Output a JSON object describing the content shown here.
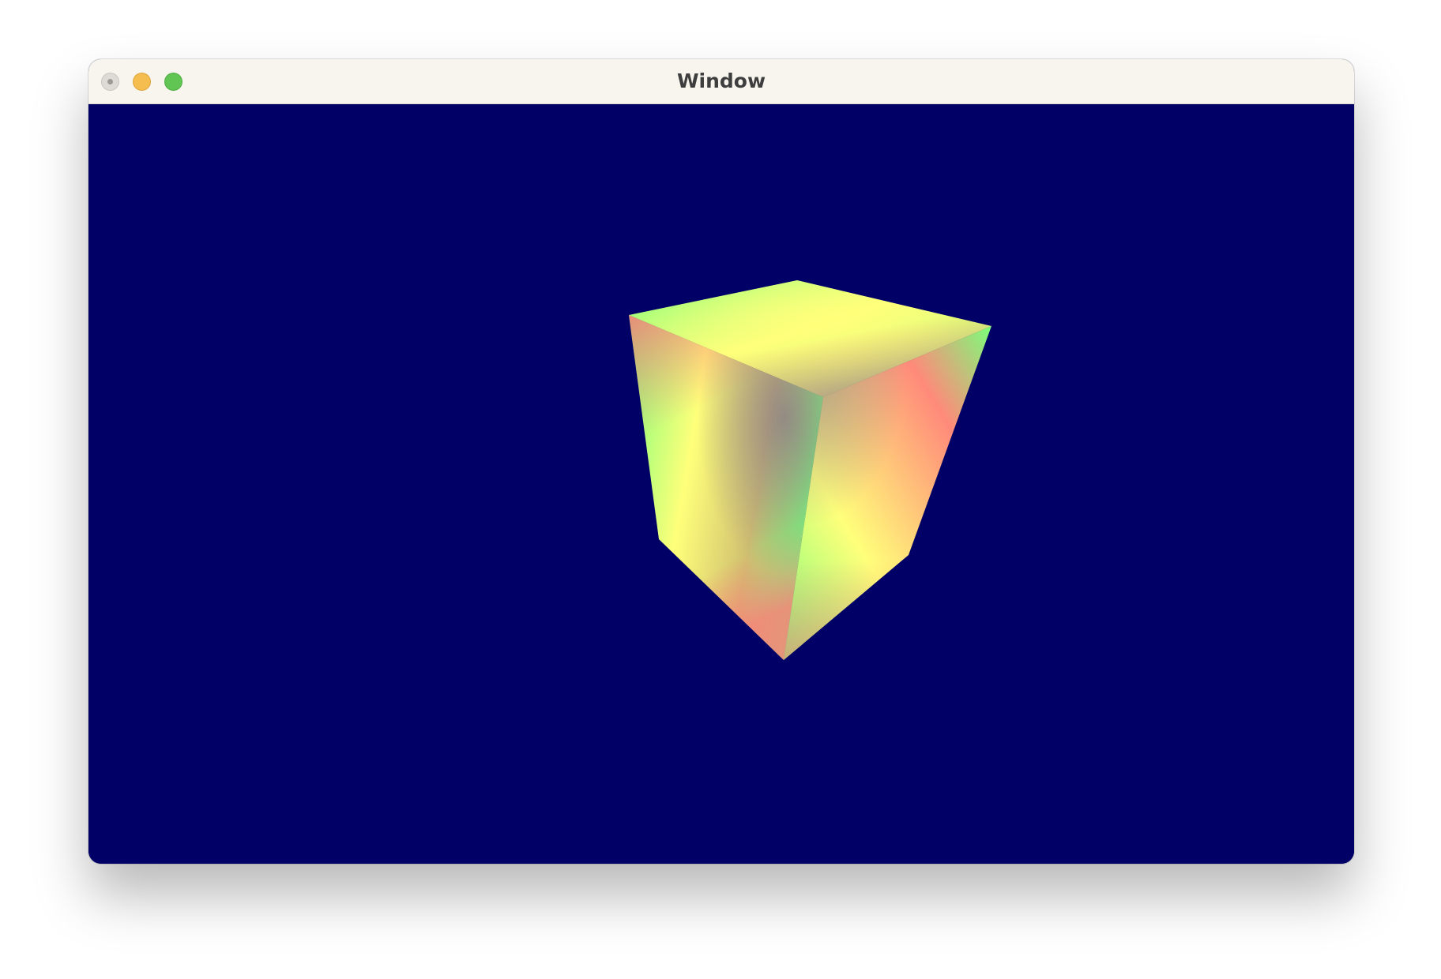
{
  "window": {
    "title": "Window",
    "background_color": "#000066"
  },
  "title_bar": {
    "buttons": [
      {
        "name": "close",
        "color": "#dedbd6"
      },
      {
        "name": "minimize",
        "color": "#f5bd4f"
      },
      {
        "name": "zoom",
        "color": "#61c554"
      }
    ]
  },
  "scene": {
    "object": "rotating-cube",
    "colors": [
      "#ff7a7a",
      "#ffff7a",
      "#7aff7a",
      "#8a8a8a"
    ]
  }
}
